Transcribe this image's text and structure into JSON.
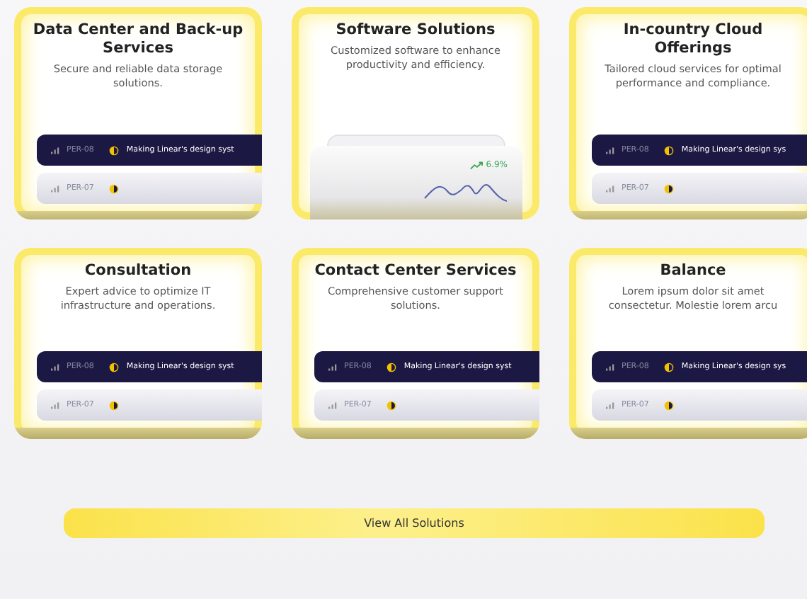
{
  "cards": [
    {
      "title": "Data Center and Back-up Services",
      "description": "Secure and reliable data storage solutions.",
      "preview": {
        "kind": "tickets",
        "tickets": [
          {
            "id": "PER-08",
            "text": "Making Linear's design syst",
            "dark": true
          },
          {
            "id": "PER-07",
            "dark": false
          }
        ]
      }
    },
    {
      "title": "Software Solutions",
      "description": "Customized software to enhance productivity and efficiency.",
      "preview": {
        "kind": "chart",
        "change": "6.9%"
      }
    },
    {
      "title": "In-country Cloud Offerings",
      "description": "Tailored cloud services for optimal performance and compliance.",
      "preview": {
        "kind": "tickets",
        "tickets": [
          {
            "id": "PER-08",
            "text": "Making Linear's design sys",
            "dark": true
          },
          {
            "id": "PER-07",
            "dark": false
          }
        ]
      }
    },
    {
      "title": "Consultation",
      "description": "Expert advice to optimize IT infrastructure and operations.",
      "preview": {
        "kind": "tickets",
        "tickets": [
          {
            "id": "PER-08",
            "text": "Making Linear's design syst",
            "dark": true
          },
          {
            "id": "PER-07",
            "dark": false
          }
        ]
      }
    },
    {
      "title": "Contact Center Services",
      "description": "Comprehensive customer support solutions.",
      "preview": {
        "kind": "tickets",
        "tickets": [
          {
            "id": "PER-08",
            "text": "Making Linear's design syst",
            "dark": true
          },
          {
            "id": "PER-07",
            "dark": false
          }
        ]
      }
    },
    {
      "title": "Balance",
      "description": "Lorem ipsum dolor sit amet consectetur. Molestie lorem arcu",
      "preview": {
        "kind": "tickets",
        "tickets": [
          {
            "id": "PER-08",
            "text": "Making Linear's design sys",
            "dark": true
          },
          {
            "id": "PER-07",
            "dark": false
          }
        ]
      }
    }
  ],
  "button": "View All Solutions"
}
